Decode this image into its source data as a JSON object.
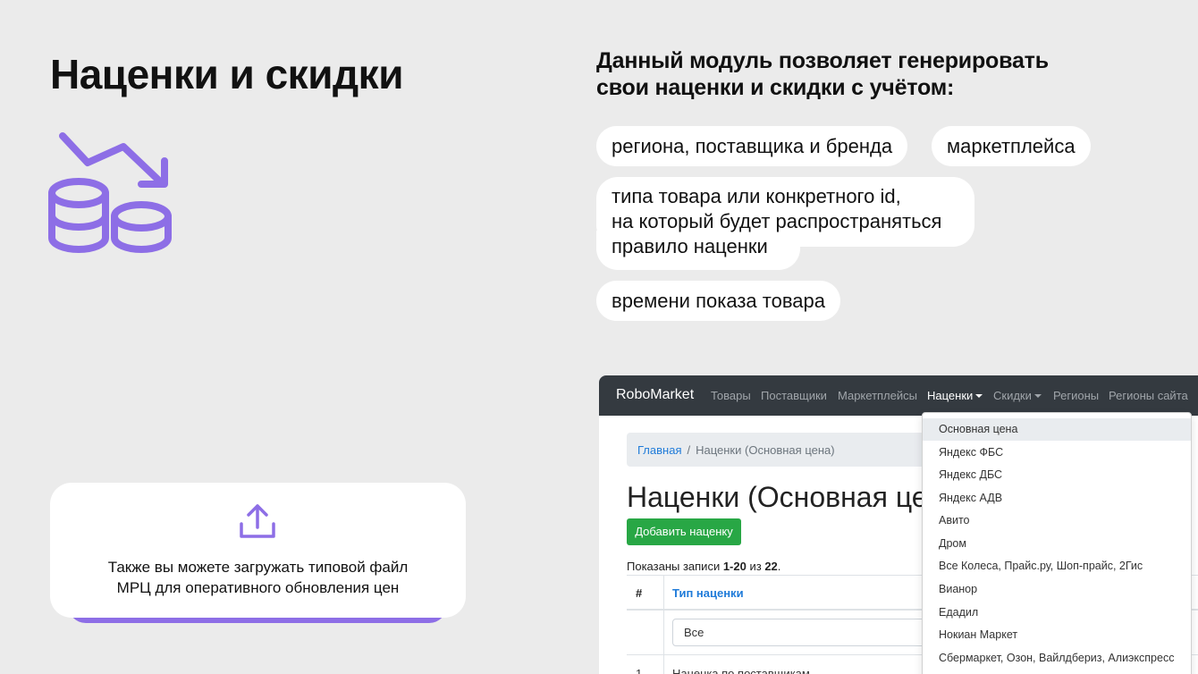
{
  "slide": {
    "title": "Наценки и скидки",
    "intro_line1": "Данный модуль позволяет генерировать",
    "intro_line2": "свои наценки и скидки с учётом:",
    "accent_color": "#8d6ee6"
  },
  "bubbles": {
    "b1": "региона, поставщика и бренда",
    "b2": "маркетплейса",
    "b3_line1": "типа товара или конкретного id,",
    "b3_line2": "на который будет распространяться",
    "b3_line3": "правило наценки",
    "b4": "времени показа товара"
  },
  "upload": {
    "icon": "upload-icon",
    "line1": "Также вы можете загружать типовой файл",
    "line2": "МРЦ для оперативного обновления цен"
  },
  "screenshot": {
    "brand": "RoboMarket",
    "nav": [
      "Товары",
      "Поставщики",
      "Маркетплейсы",
      "Наценки",
      "Скидки",
      "Регионы",
      "Регионы сайта"
    ],
    "breadcrumb_home": "Главная",
    "breadcrumb_sep": "/",
    "breadcrumb_current": "Наценки (Основная цена)",
    "page_title": "Наценки (Основная це",
    "add_button": "Добавить наценку",
    "summary_prefix": "Показаны записи ",
    "summary_range": "1-20",
    "summary_mid": " из ",
    "summary_total": "22",
    "summary_suffix": ".",
    "col_num": "#",
    "col_type": "Тип наценки",
    "filter_value": "Все",
    "row1_num": "1",
    "row1_text": "Наценка по поставщикам",
    "dropdown": [
      "Основная цена",
      "Яндекс ФБС",
      "Яндекс ДБС",
      "Яндекс АДВ",
      "Авито",
      "Дром",
      "Все Колеса, Прайс.ру, Шоп-прайс, 2Гис",
      "Вианор",
      "Едадил",
      "Нокиан Маркет",
      "Сбермаркет, Озон, Вайлдбериз, Алиэкспресс"
    ]
  }
}
